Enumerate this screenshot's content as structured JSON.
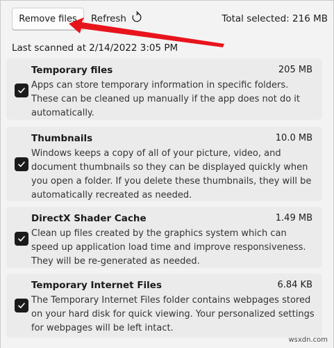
{
  "toolbar": {
    "remove_label": "Remove files",
    "refresh_label": "Refresh",
    "total_selected": "Total selected: 216 MB"
  },
  "last_scanned": "Last scanned at 2/14/2022 3:05 PM",
  "items": [
    {
      "title": "Temporary files",
      "size": "205 MB",
      "description": "Apps can store temporary information in specific folders. These can be cleaned up manually if the app does not do it automatically.",
      "checked": true
    },
    {
      "title": "Thumbnails",
      "size": "10.0 MB",
      "description": "Windows keeps a copy of all of your picture, video, and document thumbnails so they can be displayed quickly when you open a folder. If you delete these thumbnails, they will be automatically recreated as needed.",
      "checked": true
    },
    {
      "title": "DirectX Shader Cache",
      "size": "1.49 MB",
      "description": "Clean up files created by the graphics system which can speed up application load time and improve responsiveness. They will be re-generated as needed.",
      "checked": true
    },
    {
      "title": "Temporary Internet Files",
      "size": "6.84 KB",
      "description": "The Temporary Internet Files folder contains webpages stored on your hard disk for quick viewing. Your personalized settings for webpages will be left intact.",
      "checked": true
    }
  ],
  "watermark": "wsxdn.com",
  "colors": {
    "arrow": "#e8141c",
    "checkbox": "#1b1b1b",
    "card": "#ebebeb",
    "background": "#f3f3f3"
  }
}
